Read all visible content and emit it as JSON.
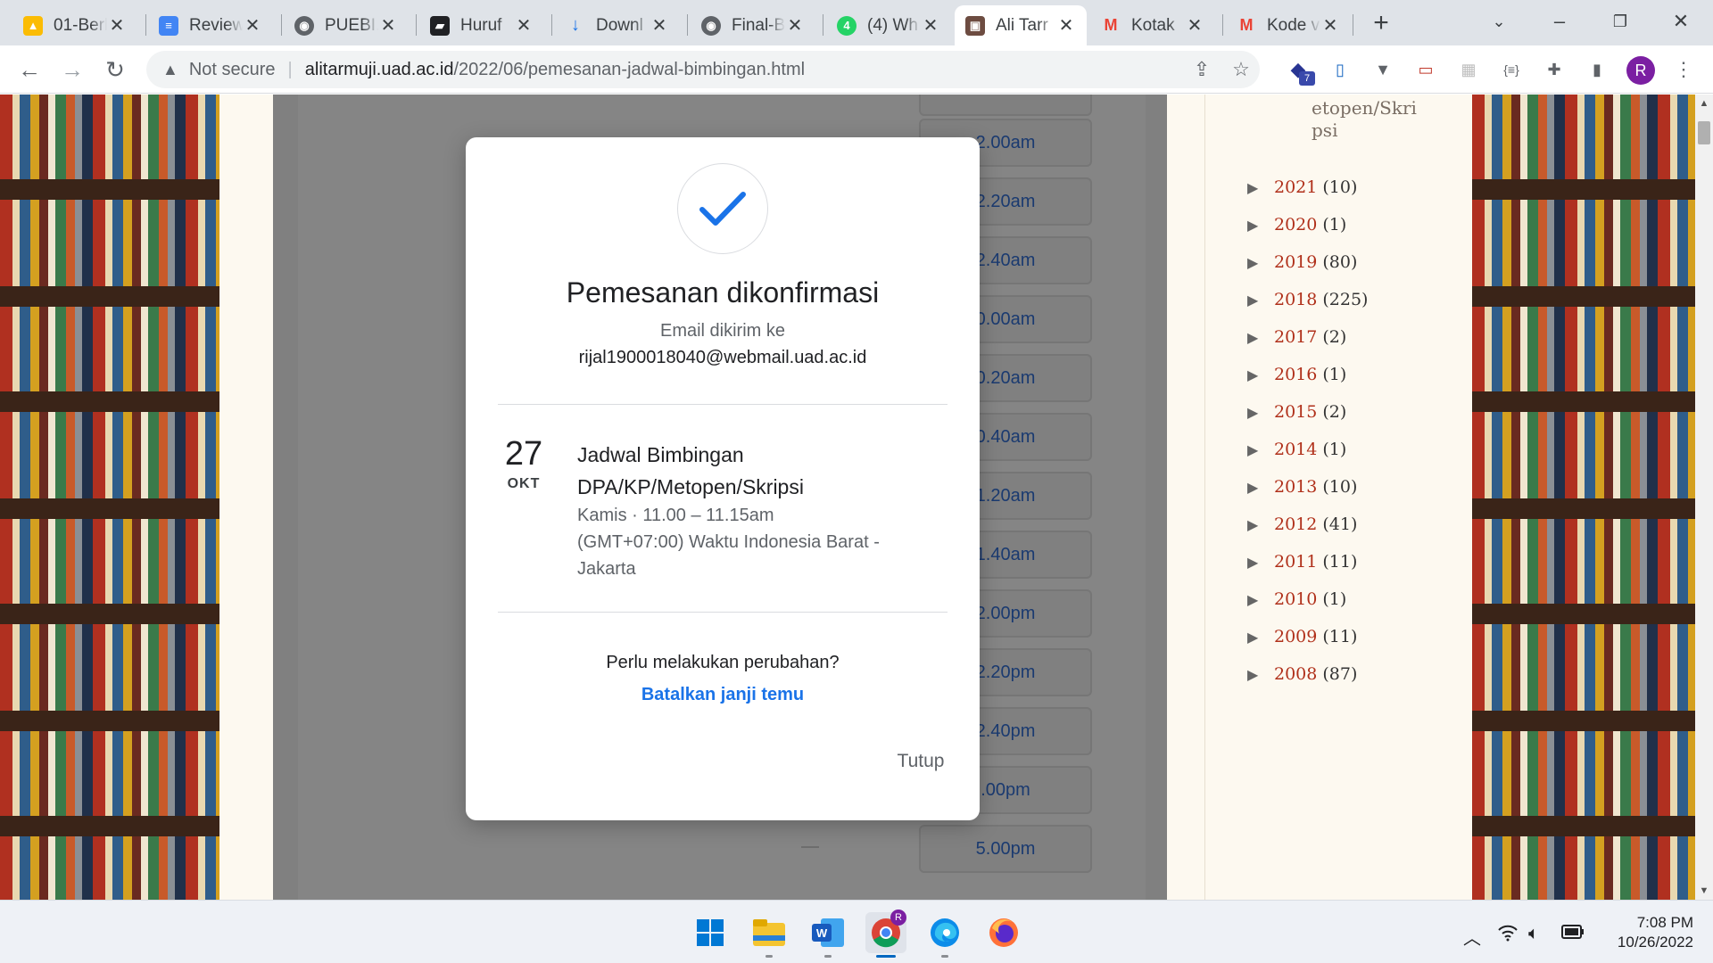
{
  "browser": {
    "tabs": [
      {
        "title": "01-Berl",
        "fav_color": "#fbbc04",
        "fav_glyph": "▲"
      },
      {
        "title": "Review",
        "fav_color": "#4285f4",
        "fav_glyph": "≡"
      },
      {
        "title": "PUEBI.",
        "fav_color": "#5f6368",
        "fav_glyph": "◉"
      },
      {
        "title": "Huruf",
        "fav_color": "#202124",
        "fav_glyph": "▰"
      },
      {
        "title": "Downl",
        "fav_color": "#1a73e8",
        "fav_glyph": "↓"
      },
      {
        "title": "Final-B",
        "fav_color": "#5f6368",
        "fav_glyph": "◉"
      },
      {
        "title": "(4) Wh",
        "fav_color": "#25d366",
        "fav_glyph": "4"
      },
      {
        "title": "Ali Tarr",
        "fav_color": "#6d4c41",
        "fav_glyph": "▣"
      },
      {
        "title": "Kotak",
        "fav_color": "#ea4335",
        "fav_glyph": "M"
      },
      {
        "title": "Kode v",
        "fav_color": "#ea4335",
        "fav_glyph": "M"
      }
    ],
    "address": {
      "security_label": "Not secure",
      "host": "alitarmuji.uad.ac.id",
      "path": "/2022/06/pemesanan-jadwal-bimbingan.html"
    },
    "profile_initial": "R",
    "extension_badge": "7"
  },
  "page": {
    "time_slots": [
      "2.00am",
      "2.20am",
      "2.40am",
      "0.00am",
      "0.20am",
      "0.40am",
      "1.20am",
      "1.40am",
      "2.00pm",
      "2.20pm",
      "2.40pm",
      ".00pm",
      "5.00pm"
    ],
    "sidebar": {
      "archive_top": "etopen/Skri psi",
      "years": [
        {
          "year": "2021",
          "count": "(10)"
        },
        {
          "year": "2020",
          "count": "(1)"
        },
        {
          "year": "2019",
          "count": "(80)"
        },
        {
          "year": "2018",
          "count": "(225)"
        },
        {
          "year": "2017",
          "count": "(2)"
        },
        {
          "year": "2016",
          "count": "(1)"
        },
        {
          "year": "2015",
          "count": "(2)"
        },
        {
          "year": "2014",
          "count": "(1)"
        },
        {
          "year": "2013",
          "count": "(10)"
        },
        {
          "year": "2012",
          "count": "(41)"
        },
        {
          "year": "2011",
          "count": "(11)"
        },
        {
          "year": "2010",
          "count": "(1)"
        },
        {
          "year": "2009",
          "count": "(11)"
        },
        {
          "year": "2008",
          "count": "(87)"
        }
      ]
    }
  },
  "dialog": {
    "title": "Pemesanan dikonfirmasi",
    "email_sent_label": "Email dikirim ke",
    "email": "rijal1900018040@webmail.uad.ac.id",
    "date_day": "27",
    "date_month": "OKT",
    "event_title": "Jadwal Bimbingan DPA/KP/Metopen/Skripsi",
    "event_time": "Kamis · 11.00 – 11.15am",
    "timezone": "(GMT+07:00) Waktu Indonesia Barat - Jakarta",
    "change_question": "Perlu melakukan perubahan?",
    "cancel_link": "Batalkan janji temu",
    "close_button": "Tutup",
    "accent_color": "#1a73e8"
  },
  "taskbar": {
    "chrome_badge": "R",
    "time": "7:08 PM",
    "date": "10/26/2022"
  }
}
